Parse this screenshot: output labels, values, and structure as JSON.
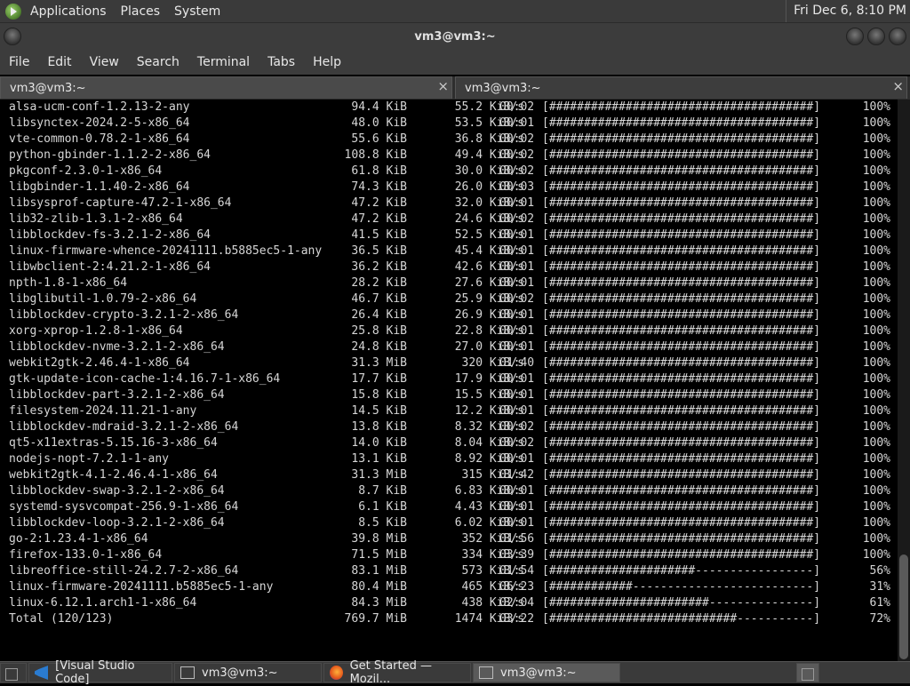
{
  "top_panel": {
    "menus": [
      "Applications",
      "Places",
      "System"
    ],
    "clock": "Fri Dec  6,  8:10 PM"
  },
  "window": {
    "title": "vm3@vm3:~"
  },
  "menubar": [
    "File",
    "Edit",
    "View",
    "Search",
    "Terminal",
    "Tabs",
    "Help"
  ],
  "tabs": [
    {
      "label": "vm3@vm3:~",
      "close": "×"
    },
    {
      "label": "vm3@vm3:~",
      "close": "×"
    }
  ],
  "rows": [
    {
      "name": "alsa-ucm-conf-1.2.13-2-any",
      "size": "94.4 KiB",
      "speed": "55.2 KiB/s",
      "time": "00:02",
      "bar": "[######################################]",
      "pct": "100%"
    },
    {
      "name": "libsynctex-2024.2-5-x86_64",
      "size": "48.0 KiB",
      "speed": "53.5 KiB/s",
      "time": "00:01",
      "bar": "[######################################]",
      "pct": "100%"
    },
    {
      "name": "vte-common-0.78.2-1-x86_64",
      "size": "55.6 KiB",
      "speed": "36.8 KiB/s",
      "time": "00:02",
      "bar": "[######################################]",
      "pct": "100%"
    },
    {
      "name": "python-gbinder-1.1.2-2-x86_64",
      "size": "108.8 KiB",
      "speed": "49.4 KiB/s",
      "time": "00:02",
      "bar": "[######################################]",
      "pct": "100%"
    },
    {
      "name": "pkgconf-2.3.0-1-x86_64",
      "size": "61.8 KiB",
      "speed": "30.0 KiB/s",
      "time": "00:02",
      "bar": "[######################################]",
      "pct": "100%"
    },
    {
      "name": "libgbinder-1.1.40-2-x86_64",
      "size": "74.3 KiB",
      "speed": "26.0 KiB/s",
      "time": "00:03",
      "bar": "[######################################]",
      "pct": "100%"
    },
    {
      "name": "libsysprof-capture-47.2-1-x86_64",
      "size": "47.2 KiB",
      "speed": "32.0 KiB/s",
      "time": "00:01",
      "bar": "[######################################]",
      "pct": "100%"
    },
    {
      "name": "lib32-zlib-1.3.1-2-x86_64",
      "size": "47.2 KiB",
      "speed": "24.6 KiB/s",
      "time": "00:02",
      "bar": "[######################################]",
      "pct": "100%"
    },
    {
      "name": "libblockdev-fs-3.2.1-2-x86_64",
      "size": "41.5 KiB",
      "speed": "52.5 KiB/s",
      "time": "00:01",
      "bar": "[######################################]",
      "pct": "100%"
    },
    {
      "name": "linux-firmware-whence-20241111.b5885ec5-1-any",
      "size": "36.5 KiB",
      "speed": "45.4 KiB/s",
      "time": "00:01",
      "bar": "[######################################]",
      "pct": "100%"
    },
    {
      "name": "libwbclient-2:4.21.2-1-x86_64",
      "size": "36.2 KiB",
      "speed": "42.6 KiB/s",
      "time": "00:01",
      "bar": "[######################################]",
      "pct": "100%"
    },
    {
      "name": "npth-1.8-1-x86_64",
      "size": "28.2 KiB",
      "speed": "27.6 KiB/s",
      "time": "00:01",
      "bar": "[######################################]",
      "pct": "100%"
    },
    {
      "name": "libglibutil-1.0.79-2-x86_64",
      "size": "46.7 KiB",
      "speed": "25.9 KiB/s",
      "time": "00:02",
      "bar": "[######################################]",
      "pct": "100%"
    },
    {
      "name": "libblockdev-crypto-3.2.1-2-x86_64",
      "size": "26.4 KiB",
      "speed": "26.9 KiB/s",
      "time": "00:01",
      "bar": "[######################################]",
      "pct": "100%"
    },
    {
      "name": "xorg-xprop-1.2.8-1-x86_64",
      "size": "25.8 KiB",
      "speed": "22.8 KiB/s",
      "time": "00:01",
      "bar": "[######################################]",
      "pct": "100%"
    },
    {
      "name": "libblockdev-nvme-3.2.1-2-x86_64",
      "size": "24.8 KiB",
      "speed": "27.0 KiB/s",
      "time": "00:01",
      "bar": "[######################################]",
      "pct": "100%"
    },
    {
      "name": "webkit2gtk-2.46.4-1-x86_64",
      "size": "31.3 MiB",
      "speed": "320 KiB/s",
      "time": "01:40",
      "bar": "[######################################]",
      "pct": "100%"
    },
    {
      "name": "gtk-update-icon-cache-1:4.16.7-1-x86_64",
      "size": "17.7 KiB",
      "speed": "17.9 KiB/s",
      "time": "00:01",
      "bar": "[######################################]",
      "pct": "100%"
    },
    {
      "name": "libblockdev-part-3.2.1-2-x86_64",
      "size": "15.8 KiB",
      "speed": "15.5 KiB/s",
      "time": "00:01",
      "bar": "[######################################]",
      "pct": "100%"
    },
    {
      "name": "filesystem-2024.11.21-1-any",
      "size": "14.5 KiB",
      "speed": "12.2 KiB/s",
      "time": "00:01",
      "bar": "[######################################]",
      "pct": "100%"
    },
    {
      "name": "libblockdev-mdraid-3.2.1-2-x86_64",
      "size": "13.8 KiB",
      "speed": "8.32 KiB/s",
      "time": "00:02",
      "bar": "[######################################]",
      "pct": "100%"
    },
    {
      "name": "qt5-x11extras-5.15.16-3-x86_64",
      "size": "14.0 KiB",
      "speed": "8.04 KiB/s",
      "time": "00:02",
      "bar": "[######################################]",
      "pct": "100%"
    },
    {
      "name": "nodejs-nopt-7.2.1-1-any",
      "size": "13.1 KiB",
      "speed": "8.92 KiB/s",
      "time": "00:01",
      "bar": "[######################################]",
      "pct": "100%"
    },
    {
      "name": "webkit2gtk-4.1-2.46.4-1-x86_64",
      "size": "31.3 MiB",
      "speed": "315 KiB/s",
      "time": "01:42",
      "bar": "[######################################]",
      "pct": "100%"
    },
    {
      "name": "libblockdev-swap-3.2.1-2-x86_64",
      "size": "8.7 KiB",
      "speed": "6.83 KiB/s",
      "time": "00:01",
      "bar": "[######################################]",
      "pct": "100%"
    },
    {
      "name": "systemd-sysvcompat-256.9-1-x86_64",
      "size": "6.1 KiB",
      "speed": "4.43 KiB/s",
      "time": "00:01",
      "bar": "[######################################]",
      "pct": "100%"
    },
    {
      "name": "libblockdev-loop-3.2.1-2-x86_64",
      "size": "8.5 KiB",
      "speed": "6.02 KiB/s",
      "time": "00:01",
      "bar": "[######################################]",
      "pct": "100%"
    },
    {
      "name": "go-2:1.23.4-1-x86_64",
      "size": "39.8 MiB",
      "speed": "352 KiB/s",
      "time": "01:56",
      "bar": "[######################################]",
      "pct": "100%"
    },
    {
      "name": "firefox-133.0-1-x86_64",
      "size": "71.5 MiB",
      "speed": "334 KiB/s",
      "time": "03:39",
      "bar": "[######################################]",
      "pct": "100%"
    },
    {
      "name": "libreoffice-still-24.2.7-2-x86_64",
      "size": "83.1 MiB",
      "speed": "573 KiB/s",
      "time": "01:54",
      "bar": "[#####################-----------------]",
      "pct": "56%"
    },
    {
      "name": "linux-firmware-20241111.b5885ec5-1-any",
      "size": "80.4 MiB",
      "speed": "465 KiB/s",
      "time": "06:23",
      "bar": "[############--------------------------]",
      "pct": "31%"
    },
    {
      "name": "linux-6.12.1.arch1-1-x86_64",
      "size": "84.3 MiB",
      "speed": "438 KiB/s",
      "time": "02:04",
      "bar": "[#######################---------------]",
      "pct": "61%"
    },
    {
      "name": "Total (120/123)",
      "size": "769.7 MiB",
      "speed": "1474 KiB/s",
      "time": "03:22",
      "bar": "[###########################-----------]",
      "pct": "72%"
    }
  ],
  "taskbar": [
    {
      "label": "[Visual Studio Code]",
      "icon": "vscode-icon"
    },
    {
      "label": "vm3@vm3:~",
      "icon": "terminal-icon"
    },
    {
      "label": "Get Started — Mozil...",
      "icon": "firefox-icon"
    },
    {
      "label": "vm3@vm3:~",
      "icon": "terminal-icon"
    }
  ]
}
